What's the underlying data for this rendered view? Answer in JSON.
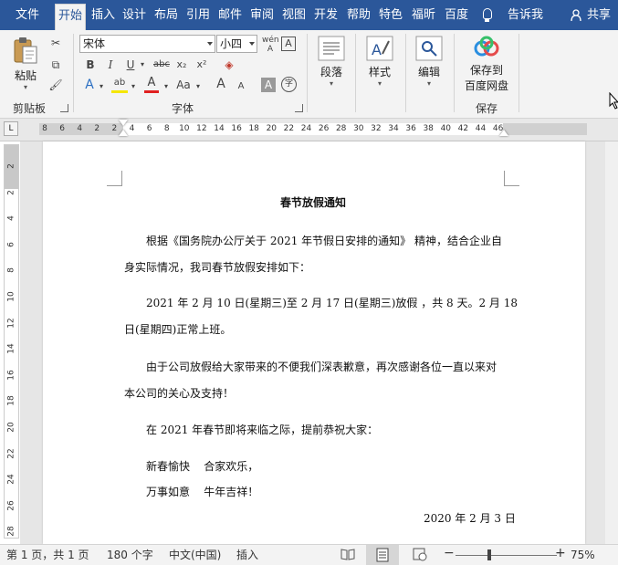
{
  "tabs": [
    {
      "label": "文件",
      "active": false
    },
    {
      "label": "开始",
      "active": true
    },
    {
      "label": "插入",
      "active": false
    },
    {
      "label": "设计",
      "active": false
    },
    {
      "label": "布局",
      "active": false
    },
    {
      "label": "引用",
      "active": false
    },
    {
      "label": "邮件",
      "active": false
    },
    {
      "label": "审阅",
      "active": false
    },
    {
      "label": "视图",
      "active": false
    },
    {
      "label": "开发",
      "active": false
    },
    {
      "label": "帮助",
      "active": false
    },
    {
      "label": "特色",
      "active": false
    },
    {
      "label": "福昕",
      "active": false
    },
    {
      "label": "百度",
      "active": false
    }
  ],
  "tell_me": {
    "label": "告诉我",
    "icon": "lightbulb-icon"
  },
  "share": {
    "label": "共享",
    "icon": "person-icon"
  },
  "clipboard": {
    "paste_label": "粘贴",
    "group_label": "剪贴板"
  },
  "font": {
    "font_name": "宋体",
    "font_size": "小四",
    "group_label": "字体",
    "bold": "B",
    "italic": "I",
    "underline": "U",
    "strike": "abc",
    "sub": "x₂",
    "sup": "x²",
    "phonetic": "wén",
    "border_char": "A",
    "grow": "A",
    "shrink": "A",
    "case": "Aa",
    "shade": "A",
    "circle": "字",
    "highlight_icon": "ab"
  },
  "paragraph": {
    "label": "段落"
  },
  "styles": {
    "label": "样式"
  },
  "editing": {
    "label": "编辑"
  },
  "save": {
    "label_line1": "保存到",
    "label_line2": "百度网盘",
    "group_label": "保存"
  },
  "ruler": {
    "ticks": [
      "8",
      "6",
      "4",
      "2",
      "2",
      "4",
      "6",
      "8",
      "10",
      "12",
      "14",
      "16",
      "18",
      "20",
      "22",
      "24",
      "26",
      "28",
      "30",
      "32",
      "34",
      "36",
      "38",
      "40",
      "42",
      "44",
      "46"
    ],
    "corner": "L"
  },
  "vruler": {
    "ticks": [
      "2",
      "2",
      "4",
      "6",
      "8",
      "10",
      "12",
      "14",
      "16",
      "18",
      "20",
      "22",
      "24",
      "26",
      "28"
    ]
  },
  "document": {
    "title": "春节放假通知",
    "p1_line1": "根据《国务院办公厅关于 2021 年节假日安排的通知》 精神，结合企业自",
    "p1_line2": "身实际情况，我司春节放假安排如下：",
    "p2_line1": "2021 年 2 月 10 日(星期三)至 2 月 17 日(星期三)放假 ，共 8 天。2 月 18",
    "p2_line2": "日(星期四)正常上班。",
    "p3_line1": "由于公司放假给大家带来的不便我们深表歉意，再次感谢各位一直以来对",
    "p3_line2": "本公司的关心及支持！",
    "p4": "在 2021 年春节即将来临之际，提前恭祝大家：",
    "p5": "新春愉快    合家欢乐，",
    "p6": "万事如意    牛年吉祥！",
    "date": "2020 年 2 月 3 日"
  },
  "status": {
    "page": "第 1 页，共 1 页",
    "words": "180 个字",
    "language": "中文(中国)",
    "mode": "插入",
    "zoom": "75%",
    "zoom_level": 0.75
  }
}
